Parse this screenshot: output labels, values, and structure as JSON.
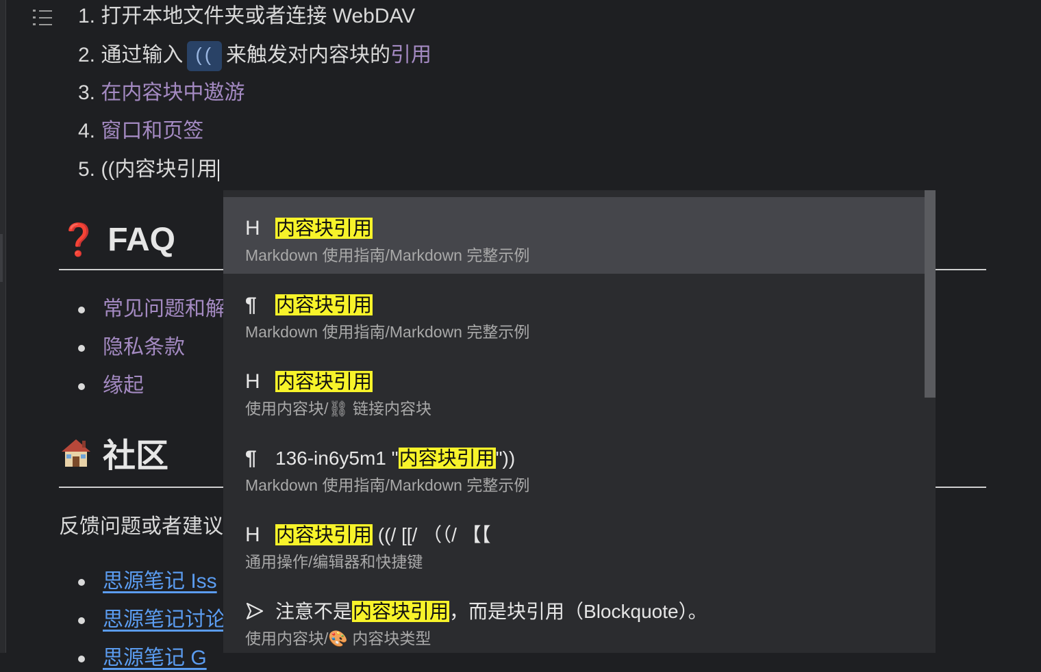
{
  "ordered_list": [
    {
      "num": "1.",
      "text": "打开本地文件夹或者连接 WebDAV"
    },
    {
      "num": "2.",
      "pre": "通过输入",
      "code": "((",
      "post": "来触发对内容块的",
      "link": "引用"
    },
    {
      "num": "3.",
      "link": "在内容块中遨游"
    },
    {
      "num": "4.",
      "link": "窗口和页签"
    },
    {
      "num": "5.",
      "text": "((内容块引用"
    }
  ],
  "faq": {
    "emoji": "❓",
    "title": "FAQ",
    "items": [
      "常见问题和解",
      "隐私条款",
      "缘起"
    ]
  },
  "community": {
    "title": "社区",
    "intro": "反馈问题或者建议",
    "links": [
      "思源笔记 Iss",
      "思源笔记讨论",
      "思源笔记 G"
    ]
  },
  "popup": {
    "items": [
      {
        "icon": "H",
        "icon_name": "heading-icon",
        "prefix": "",
        "highlight": "内容块引用",
        "suffix": "",
        "path": "Markdown 使用指南/Markdown 完整示例",
        "selected": true
      },
      {
        "icon": "¶",
        "icon_name": "paragraph-icon",
        "prefix": "",
        "highlight": "内容块引用",
        "suffix": "",
        "path": "Markdown 使用指南/Markdown 完整示例",
        "selected": false
      },
      {
        "icon": "H",
        "icon_name": "heading-icon",
        "prefix": "",
        "highlight": "内容块引用",
        "suffix": "",
        "path": "使用内容块/⛓ 链接内容块",
        "selected": false
      },
      {
        "icon": "¶",
        "icon_name": "paragraph-icon",
        "prefix": "136-in6y5m1 \"",
        "highlight": "内容块引用",
        "suffix": "\"))",
        "path": "Markdown 使用指南/Markdown 完整示例",
        "selected": false
      },
      {
        "icon": "H",
        "icon_name": "heading-icon",
        "prefix": "",
        "highlight": "内容块引用",
        "suffix": " ((/ [[/ （（/ 【【",
        "path": "通用操作/编辑器和快捷键",
        "selected": false
      },
      {
        "icon": "▷",
        "icon_name": "blockquote-icon",
        "prefix": "注意不是",
        "highlight": "内容块引用",
        "suffix": "，而是块引用（Blockquote）。",
        "path": "使用内容块/🎨 内容块类型",
        "selected": false
      }
    ]
  },
  "colors": {
    "background": "#1e1f22",
    "link_purple": "#a48ac2",
    "link_blue": "#5b9cf0",
    "highlight": "#f7f32a",
    "popup_bg": "#2b2c2f",
    "popup_selected": "#45464b"
  }
}
